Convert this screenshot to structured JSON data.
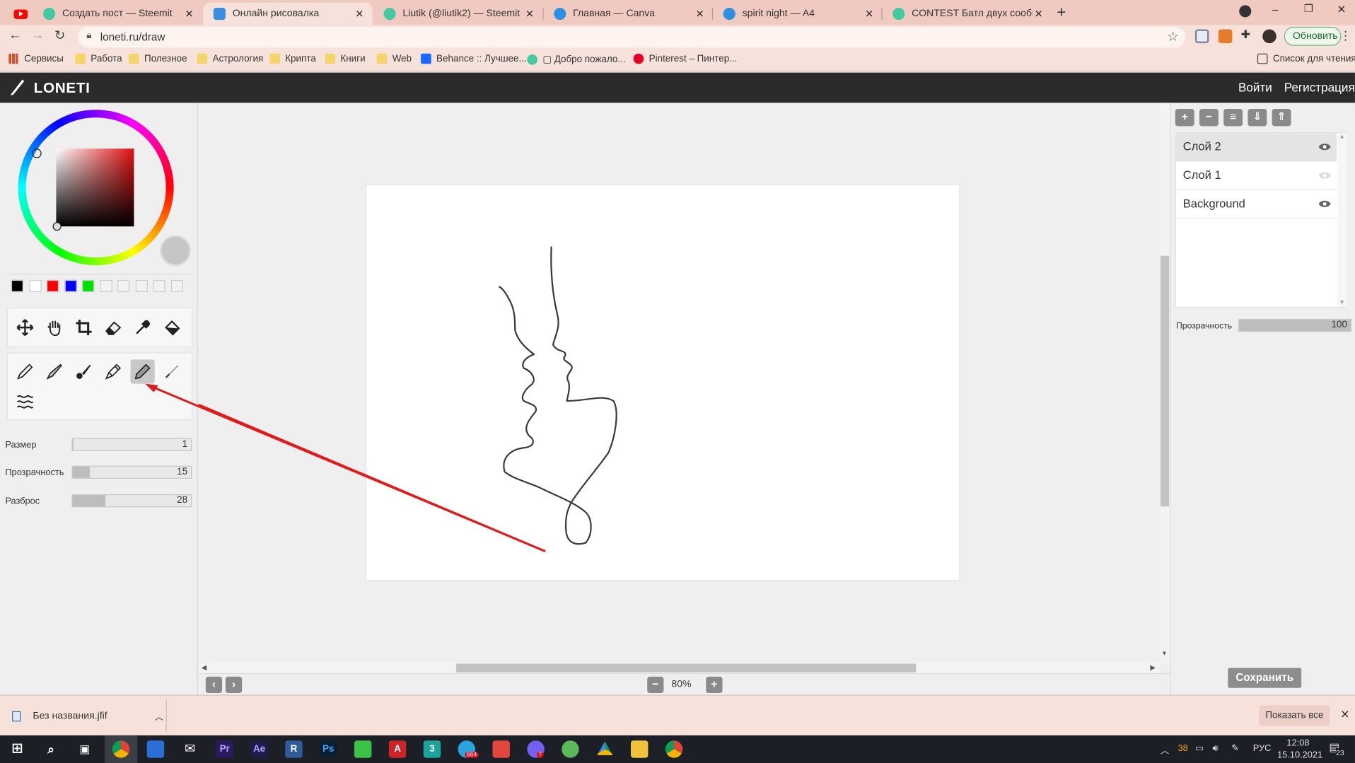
{
  "browser": {
    "tabs": [
      {
        "title": "Создать пост — Steemit",
        "favicon_color": "#46c9a0",
        "active": false
      },
      {
        "title": "Онлайн рисовалка",
        "favicon_color": "#3b8edb",
        "active": true
      },
      {
        "title": "Liutik (@liutik2) — Steemit",
        "favicon_color": "#46c9a0",
        "active": false
      },
      {
        "title": "Главная — Canva",
        "favicon_color": "#2f8fe0",
        "active": false
      },
      {
        "title": "spirit night — A4",
        "favicon_color": "#2f8fe0",
        "active": false
      },
      {
        "title": "CONTEST Батл двух сообществ",
        "favicon_color": "#46c9a0",
        "active": false
      }
    ],
    "url": "loneti.ru/draw",
    "update_button": "Обновить",
    "bookmarks": [
      "Сервисы",
      "Работа",
      "Полезное",
      "Астрология",
      "Крипта",
      "Книги",
      "Web",
      "Behance :: Лучшее...",
      "Добро пожало...",
      "Pinterest – Пинтер..."
    ],
    "reading_list": "Список для чтения"
  },
  "app": {
    "logo": "LONETI",
    "login": "Войти",
    "register": "Регистрация",
    "swatch_colors": [
      "#000000",
      "#ffffff",
      "#ff0000",
      "#0000ff",
      "#00e000",
      "#f2f2f2",
      "#f2f2f2",
      "#f2f2f2",
      "#f2f2f2",
      "#f2f2f2"
    ],
    "tools_top": [
      "move-icon",
      "hand-icon",
      "crop-icon",
      "eraser-icon",
      "eyedropper-icon",
      "fill-icon"
    ],
    "brushes": [
      "pencil-icon",
      "brush-icon",
      "round-brush-icon",
      "ink-pen-icon",
      "marker-icon",
      "airbrush-icon",
      "smudge-icon"
    ],
    "selected_brush": "marker-icon",
    "sliders": [
      {
        "label": "Размер",
        "value": "1",
        "fill": 0.01
      },
      {
        "label": "Прозрачность",
        "value": "15",
        "fill": 0.15
      },
      {
        "label": "Разброс",
        "value": "28",
        "fill": 0.28
      }
    ],
    "zoom": "80%",
    "layers_toolbar": [
      "+",
      "−",
      "≡",
      "⇓",
      "⇑"
    ],
    "layers": [
      {
        "name": "Слой 2",
        "selected": true,
        "visible": true
      },
      {
        "name": "Слой 1",
        "selected": false,
        "visible": false
      },
      {
        "name": "Background",
        "selected": false,
        "visible": true
      }
    ],
    "layer_opacity_label": "Прозрачность",
    "layer_opacity_value": "100",
    "save": "Сохранить"
  },
  "downloads": {
    "file": "Без названия.jfif",
    "show_all": "Показать все"
  },
  "taskbar": {
    "temperature": "38",
    "lang": "РУС",
    "time": "12:08",
    "date": "15.10.2021",
    "notif_count": "23",
    "badge_telegram": "664",
    "badge_viber": "7"
  },
  "colors": {
    "annotation_arrow": "#e01b1b",
    "primary_color": "#c6c6c6"
  }
}
